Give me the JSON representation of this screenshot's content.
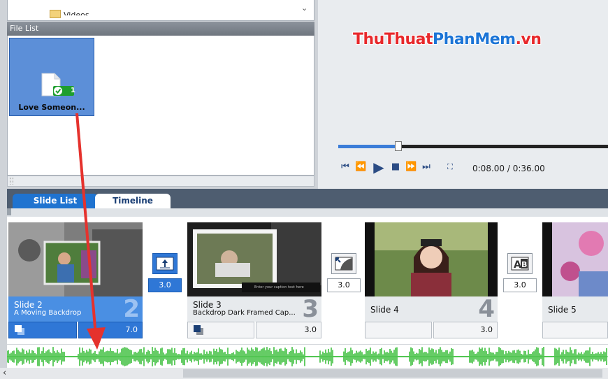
{
  "tree": {
    "folder_label": "Videos"
  },
  "file_list": {
    "header": "File List",
    "items": [
      {
        "name": "Love Someon...",
        "badge": "1",
        "icon": "audio-file-icon"
      }
    ]
  },
  "preview": {
    "brand_part1": "ThuThuat",
    "brand_part2": "PhanMem",
    "brand_part3": ".vn",
    "time": "0:08.00 / 0:36.00",
    "progress": 0.222
  },
  "tabs": [
    {
      "label": "Slide List",
      "active": true
    },
    {
      "label": "Timeline",
      "active": false
    }
  ],
  "slides": [
    {
      "title": "Slide 2",
      "subtitle": "A Moving Backdrop",
      "number": "2",
      "duration": "7.0",
      "selected": true
    },
    {
      "title": "Slide 3",
      "subtitle": "Backdrop Dark Framed Cap...",
      "number": "3",
      "duration": "3.0",
      "selected": false
    },
    {
      "title": "Slide 4",
      "subtitle": "",
      "number": "4",
      "duration": "3.0",
      "selected": false
    },
    {
      "title": "Slide 5",
      "subtitle": "",
      "number": "",
      "duration": "",
      "selected": false
    }
  ],
  "transitions": [
    {
      "value": "3.0",
      "icon": "slide-up-transition-icon"
    },
    {
      "value": "3.0",
      "icon": "grid-wipe-transition-icon"
    },
    {
      "value": "3.0",
      "icon": "letter-ab-transition-icon"
    }
  ],
  "slide3_caption": "Enter your caption text here",
  "colors": {
    "accent": "#2f77d6",
    "waveform": "#3fbf3f",
    "arrow": "#e5322d"
  }
}
